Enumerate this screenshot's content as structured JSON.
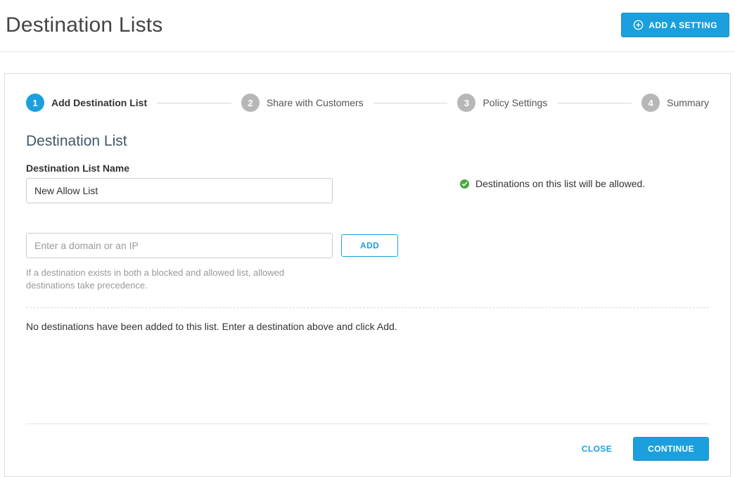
{
  "header": {
    "title": "Destination Lists",
    "add_setting_label": "ADD A SETTING"
  },
  "stepper": {
    "steps": [
      {
        "num": "1",
        "label": "Add Destination List",
        "active": true
      },
      {
        "num": "2",
        "label": "Share with Customers",
        "active": false
      },
      {
        "num": "3",
        "label": "Policy Settings",
        "active": false
      },
      {
        "num": "4",
        "label": "Summary",
        "active": false
      }
    ]
  },
  "form": {
    "section_title": "Destination List",
    "name_label": "Destination List Name",
    "name_value": "New Allow List",
    "domain_placeholder": "Enter a domain or an IP",
    "domain_value": "",
    "add_label": "ADD",
    "helper_text": "If a destination exists in both a blocked and allowed list, allowed destinations take precedence."
  },
  "info": {
    "allowed_msg": "Destinations on this list will be allowed."
  },
  "list": {
    "empty_msg": "No destinations have been added to this list. Enter a destination above and click Add."
  },
  "footer": {
    "close_label": "CLOSE",
    "continue_label": "CONTINUE"
  }
}
